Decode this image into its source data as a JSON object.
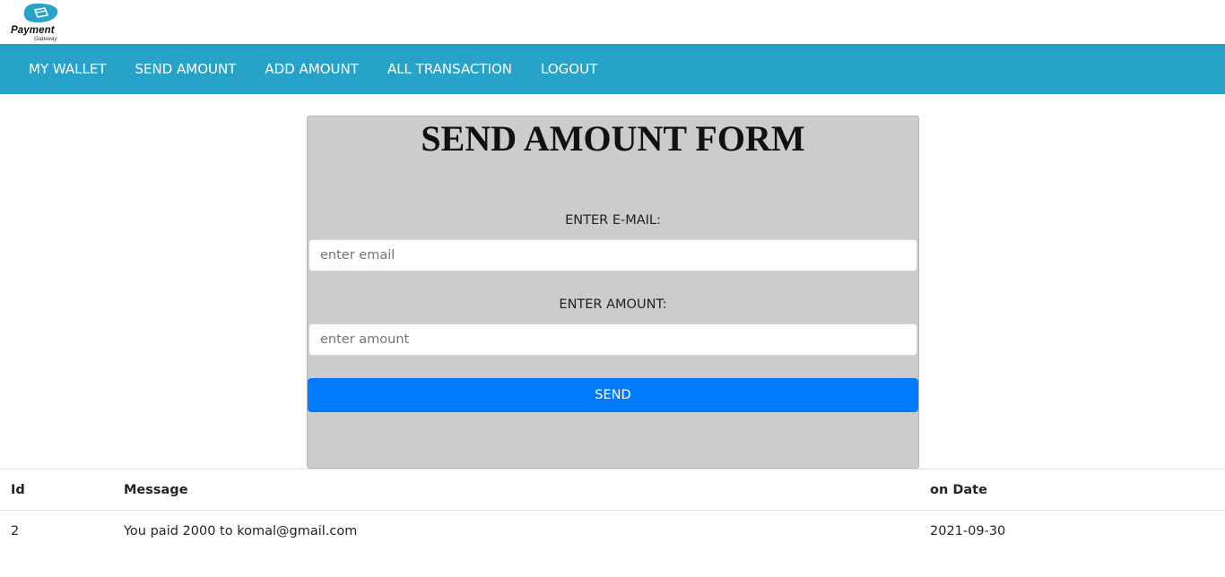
{
  "brand": {
    "name": "Payment",
    "sub": "Gateway",
    "color": "#27a2c8"
  },
  "nav": {
    "items": [
      {
        "label": "MY WALLET",
        "name": "nav-my-wallet"
      },
      {
        "label": "SEND AMOUNT",
        "name": "nav-send-amount"
      },
      {
        "label": "ADD AMOUNT",
        "name": "nav-add-amount"
      },
      {
        "label": "ALL TRANSACTION",
        "name": "nav-all-transaction"
      },
      {
        "label": "LOGOUT",
        "name": "nav-logout"
      }
    ],
    "background": "#27a2c8"
  },
  "form": {
    "title": "SEND AMOUNT FORM",
    "email_label": "ENTER E-MAIL:",
    "email_placeholder": "enter email",
    "email_value": "",
    "amount_label": "ENTER AMOUNT:",
    "amount_placeholder": "enter amount",
    "amount_value": "",
    "send_label": "SEND",
    "button_color": "#007bff"
  },
  "table": {
    "headers": {
      "id": "Id",
      "message": "Message",
      "date": "on Date"
    },
    "rows": [
      {
        "id": "2",
        "message": "You paid 2000 to komal@gmail.com",
        "date": "2021-09-30"
      }
    ]
  }
}
